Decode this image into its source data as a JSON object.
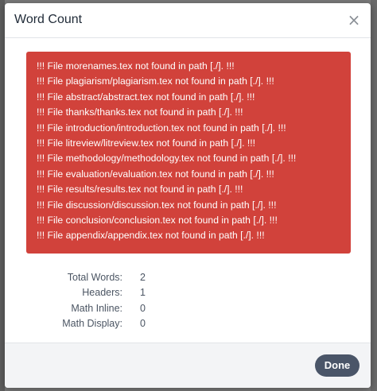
{
  "modal": {
    "title": "Word Count",
    "close_icon": "close-icon",
    "close_glyph": "×"
  },
  "errors": [
    "!!! File morenames.tex not found in path [./]. !!!",
    "!!! File plagiarism/plagiarism.tex not found in path [./]. !!!",
    "!!! File abstract/abstract.tex not found in path [./]. !!!",
    "!!! File thanks/thanks.tex not found in path [./]. !!!",
    "!!! File introduction/introduction.tex not found in path [./]. !!!",
    "!!! File litreview/litreview.tex not found in path [./]. !!!",
    "!!! File methodology/methodology.tex not found in path [./]. !!!",
    "!!! File evaluation/evaluation.tex not found in path [./]. !!!",
    "!!! File results/results.tex not found in path [./]. !!!",
    "!!! File discussion/discussion.tex not found in path [./]. !!!",
    "!!! File conclusion/conclusion.tex not found in path [./]. !!!",
    "!!! File appendix/appendix.tex not found in path [./]. !!!"
  ],
  "stats": [
    {
      "label": "Total Words:",
      "value": "2"
    },
    {
      "label": "Headers:",
      "value": "1"
    },
    {
      "label": "Math Inline:",
      "value": "0"
    },
    {
      "label": "Math Display:",
      "value": "0"
    }
  ],
  "footer": {
    "done_label": "Done"
  },
  "colors": {
    "error_background": "#d1423b",
    "done_button": "#4a5568"
  }
}
